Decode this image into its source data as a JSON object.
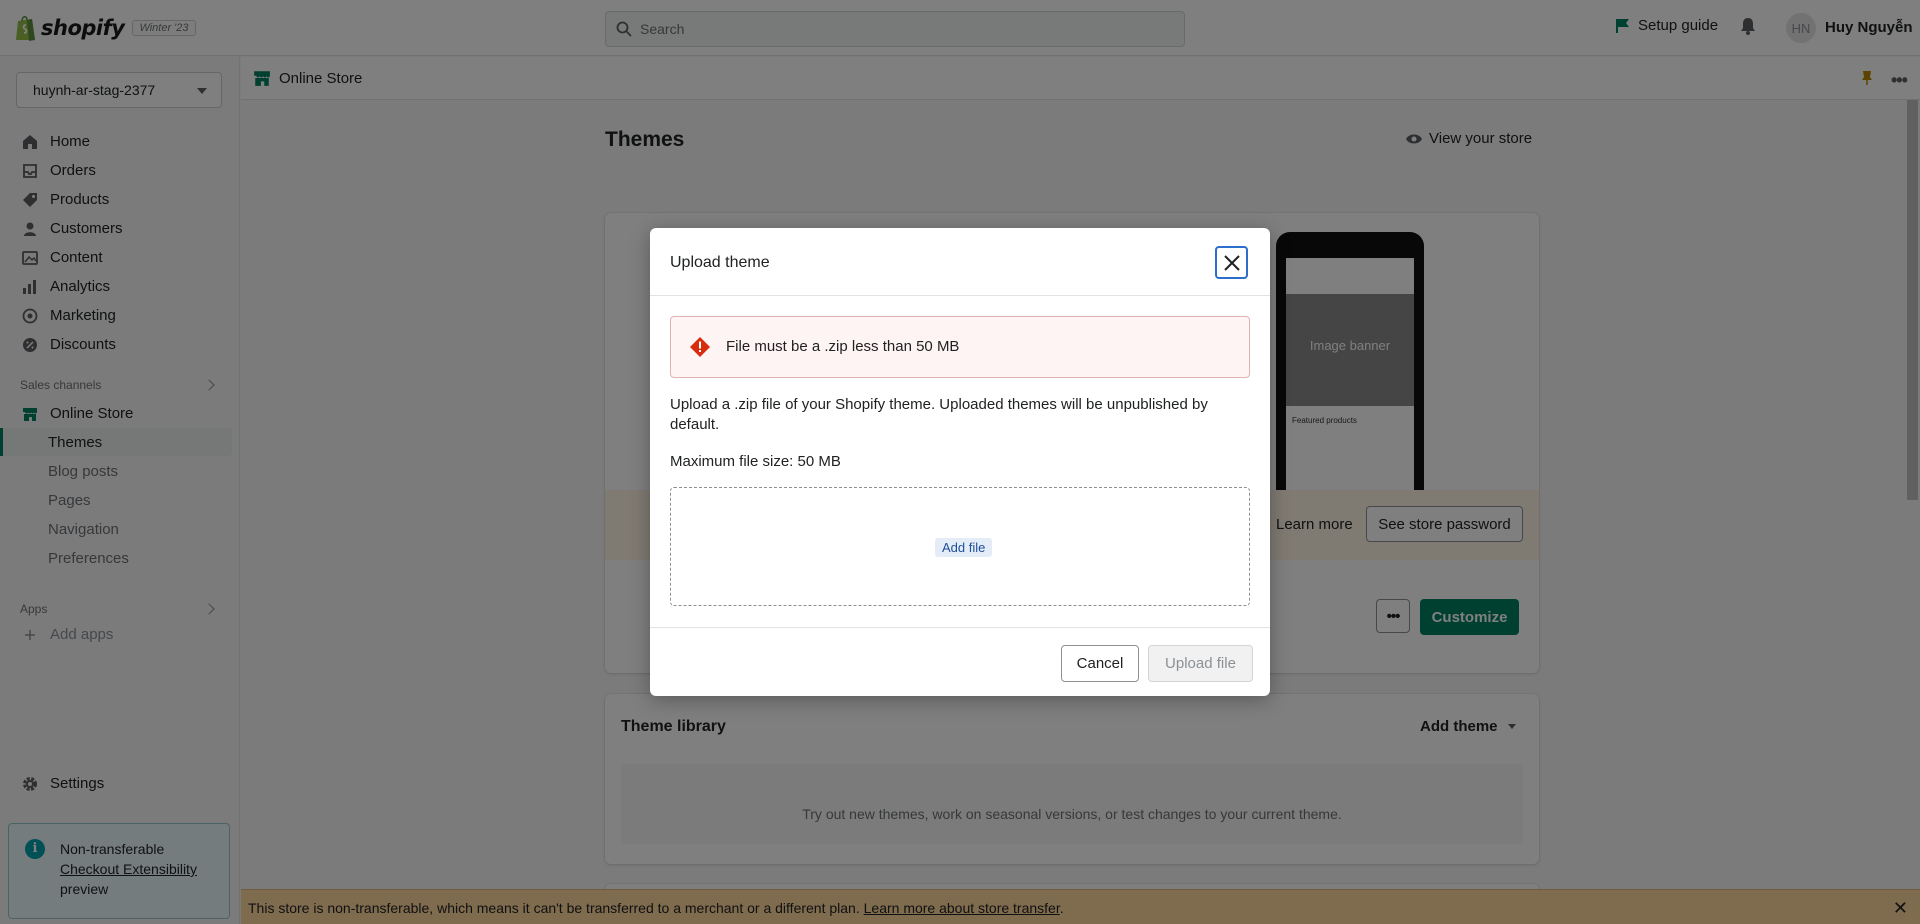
{
  "topbar": {
    "brand": "shopify",
    "edition": "Winter '23",
    "search_placeholder": "Search",
    "setup_guide": "Setup guide",
    "avatar_initials": "HN",
    "user_name": "Huy Nguyễn"
  },
  "sidebar": {
    "store_name": "huynh-ar-stag-2377",
    "items": [
      {
        "label": "Home",
        "icon": "home-icon"
      },
      {
        "label": "Orders",
        "icon": "orders-icon"
      },
      {
        "label": "Products",
        "icon": "tag-icon"
      },
      {
        "label": "Customers",
        "icon": "person-icon"
      },
      {
        "label": "Content",
        "icon": "image-icon"
      },
      {
        "label": "Analytics",
        "icon": "bar-chart-icon"
      },
      {
        "label": "Marketing",
        "icon": "target-icon"
      },
      {
        "label": "Discounts",
        "icon": "discount-icon"
      }
    ],
    "sales_channels_label": "Sales channels",
    "online_store": "Online Store",
    "sub_items": [
      "Themes",
      "Blog posts",
      "Pages",
      "Navigation",
      "Preferences"
    ],
    "apps_label": "Apps",
    "add_apps": "Add apps",
    "settings": "Settings",
    "notice": {
      "title": "Non-transferable",
      "link": "Checkout Extensibility",
      "suffix": "preview"
    }
  },
  "subheader": {
    "title": "Online Store"
  },
  "main": {
    "page_title": "Themes",
    "view_store": "View your store",
    "phone_banner": "Image banner",
    "phone_featured": "Featured products",
    "learn_more": "Learn more",
    "see_password": "See store password",
    "customize": "Customize",
    "library_title": "Theme library",
    "add_theme": "Add theme",
    "library_empty": "Try out new themes, work on seasonal versions, or test changes to your current theme."
  },
  "bottombar": {
    "text": "This store is non-transferable, which means it can't be transferred to a merchant or a different plan.",
    "link": "Learn more about store transfer",
    "period": "."
  },
  "modal": {
    "title": "Upload theme",
    "error": "File must be a .zip less than 50 MB",
    "description": "Upload a .zip file of your Shopify theme. Uploaded themes will be unpublished by default.",
    "max_size": "Maximum file size: 50 MB",
    "add_file": "Add file",
    "cancel": "Cancel",
    "upload": "Upload file"
  },
  "colors": {
    "accent": "#008060",
    "error": "#d72c0d",
    "focus": "#2c6ecb"
  }
}
